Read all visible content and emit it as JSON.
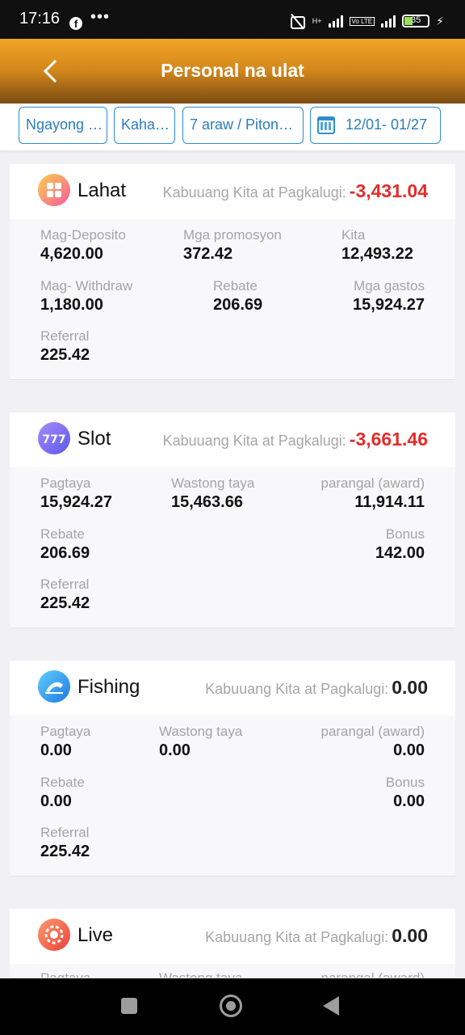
{
  "status_bar": {
    "time": "17:16",
    "dots": "•••",
    "battery": "35",
    "volte": "Vo LTE",
    "network": "H+"
  },
  "header": {
    "title": "Personal na ulat"
  },
  "filters": {
    "chip1": "Ngayong …",
    "chip2": "Kaha…",
    "chip3": "7 araw / Piton…",
    "date_range": "12/01- 01/27"
  },
  "net_label": "Kabuuang Kita at Pagkalugi:",
  "cards": [
    {
      "name": "Lahat",
      "net": "-3,431.04",
      "stats": [
        {
          "label": "Mag-Deposito",
          "value": "4,620.00"
        },
        {
          "label": "Mga promosyon",
          "value": "372.42"
        },
        {
          "label": "Kita",
          "value": "12,493.22"
        },
        {
          "label": "Mag- Withdraw",
          "value": "1,180.00"
        },
        {
          "label": "Rebate",
          "value": "206.69"
        },
        {
          "label": "Mga gastos",
          "value": "15,924.27"
        },
        {
          "label": "Referral",
          "value": "225.42"
        }
      ]
    },
    {
      "name": "Slot",
      "net": "-3,661.46",
      "stats": [
        {
          "label": "Pagtaya",
          "value": "15,924.27"
        },
        {
          "label": "Wastong taya",
          "value": "15,463.66"
        },
        {
          "label": "parangal (award)",
          "value": "11,914.11"
        },
        {
          "label": "Rebate",
          "value": "206.69"
        },
        {
          "label": "Bonus",
          "value": "142.00"
        },
        {
          "label": "Referral",
          "value": "225.42"
        }
      ]
    },
    {
      "name": "Fishing",
      "net": "0.00",
      "stats": [
        {
          "label": "Pagtaya",
          "value": "0.00"
        },
        {
          "label": "Wastong taya",
          "value": "0.00"
        },
        {
          "label": "parangal (award)",
          "value": "0.00"
        },
        {
          "label": "Rebate",
          "value": "0.00"
        },
        {
          "label": "Bonus",
          "value": "0.00"
        },
        {
          "label": "Referral",
          "value": "225.42"
        }
      ]
    },
    {
      "name": "Live",
      "net": "0.00",
      "stats": [
        {
          "label": "Pagtaya",
          "value": ""
        },
        {
          "label": "Wastong taya",
          "value": ""
        },
        {
          "label": "parangal (award)",
          "value": ""
        }
      ]
    }
  ]
}
